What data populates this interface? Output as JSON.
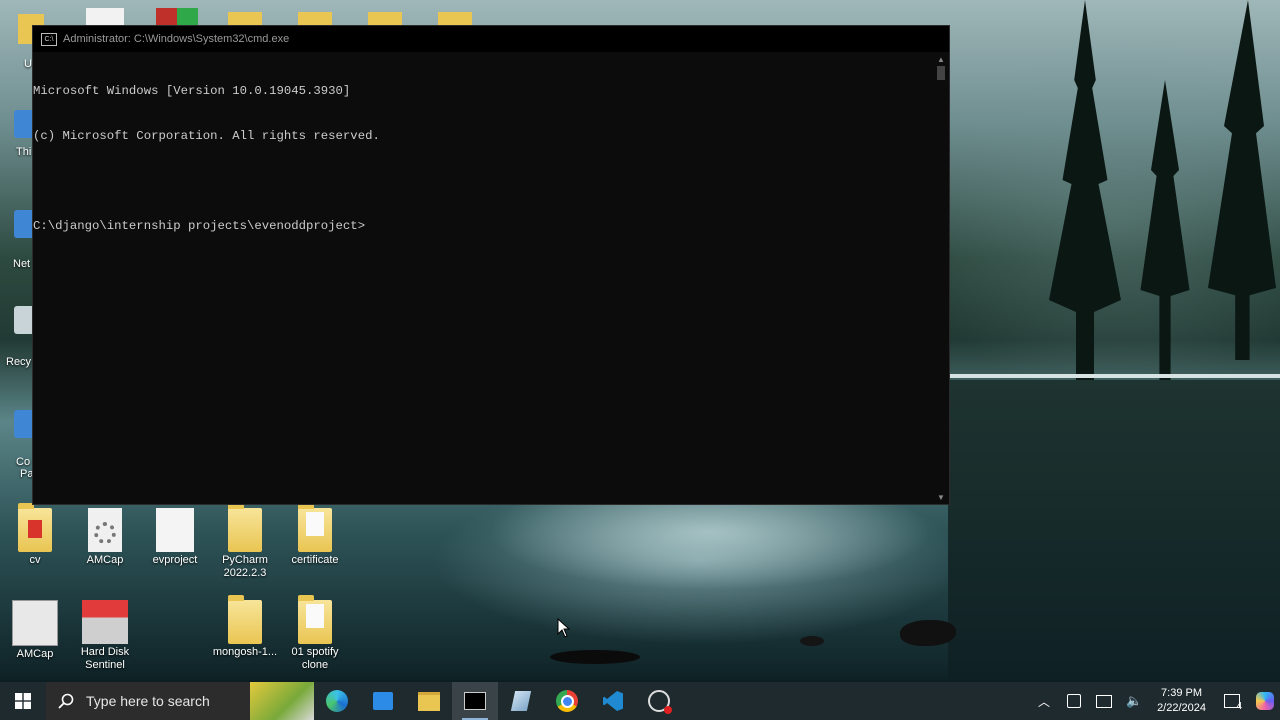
{
  "cmd": {
    "title": "Administrator: C:\\Windows\\System32\\cmd.exe",
    "lines": [
      "Microsoft Windows [Version 10.0.19045.3930]",
      "(c) Microsoft Corporation. All rights reserved.",
      "",
      "C:\\django\\internship projects\\evenoddproject>"
    ]
  },
  "desktop": {
    "left_labels": [
      "Thi",
      "Net",
      "Recy",
      "Co",
      "Pa"
    ],
    "icons_row1": [
      "cv",
      "AMCap",
      "evproject",
      "PyCharm 2022.2.3",
      "certificate"
    ],
    "icons_row2": [
      "AMCap",
      "Hard Disk Sentinel",
      "mongosh-1...",
      "01 spotify clone"
    ],
    "partial_left_label": "U"
  },
  "taskbar": {
    "search_placeholder": "Type here to search",
    "time": "7:39 PM",
    "date": "2/22/2024",
    "notification_count": "4"
  },
  "colors": {
    "console_bg": "#0c0c0c",
    "console_fg": "#cccccc",
    "taskbar_bg": "#1f2a2e"
  }
}
